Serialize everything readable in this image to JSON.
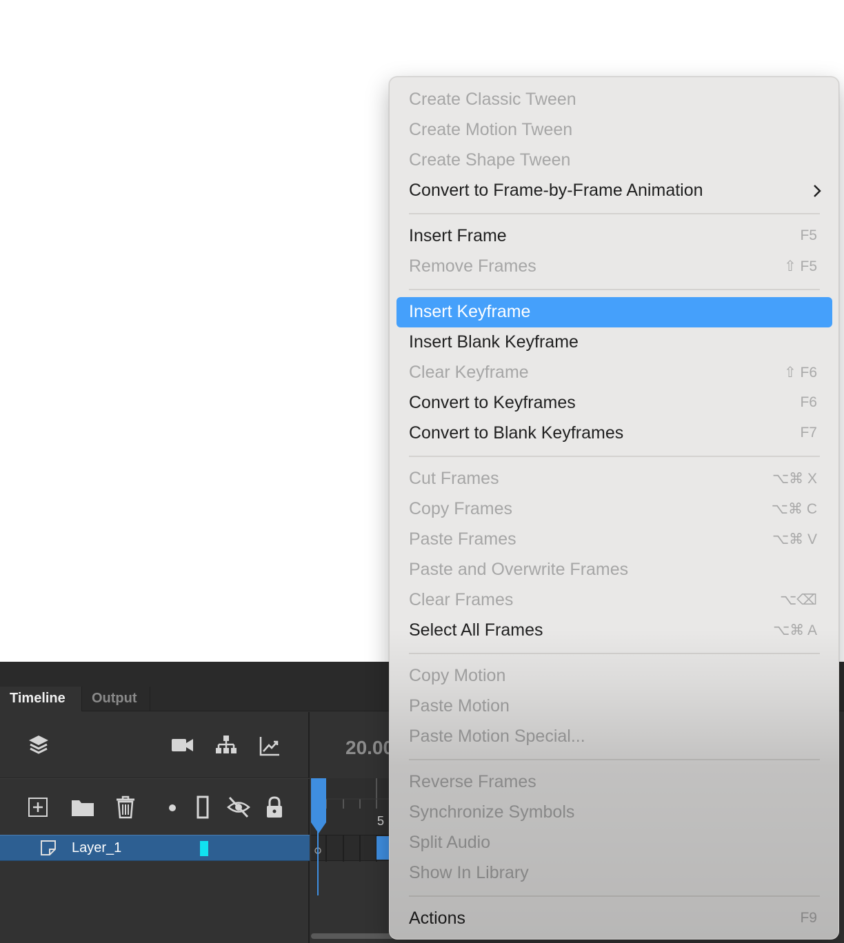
{
  "timeline": {
    "tabs": [
      "Timeline",
      "Output"
    ],
    "fps": "20.00",
    "frame_label": "5",
    "layer": {
      "name": "Layer_1",
      "color": "#11e2f0"
    }
  },
  "context_menu": {
    "items": [
      {
        "label": "Create Classic Tween",
        "shortcut": "",
        "disabled": true
      },
      {
        "label": "Create Motion Tween",
        "shortcut": "",
        "disabled": true
      },
      {
        "label": "Create Shape Tween",
        "shortcut": "",
        "disabled": true
      },
      {
        "label": "Convert to Frame-by-Frame Animation",
        "shortcut": "",
        "disabled": false,
        "submenu": true
      },
      {
        "label": "Insert Frame",
        "shortcut": "F5",
        "disabled": false
      },
      {
        "label": "Remove Frames",
        "shortcut": "⇧ F5",
        "disabled": true
      },
      {
        "label": "Insert Keyframe",
        "shortcut": "",
        "disabled": false,
        "selected": true
      },
      {
        "label": "Insert Blank Keyframe",
        "shortcut": "",
        "disabled": false
      },
      {
        "label": "Clear Keyframe",
        "shortcut": "⇧ F6",
        "disabled": true
      },
      {
        "label": "Convert to Keyframes",
        "shortcut": "F6",
        "disabled": false
      },
      {
        "label": "Convert to Blank Keyframes",
        "shortcut": "F7",
        "disabled": false
      },
      {
        "label": "Cut Frames",
        "shortcut": "⌥⌘ X",
        "disabled": true
      },
      {
        "label": "Copy Frames",
        "shortcut": "⌥⌘ C",
        "disabled": true
      },
      {
        "label": "Paste Frames",
        "shortcut": "⌥⌘ V",
        "disabled": true
      },
      {
        "label": "Paste and Overwrite Frames",
        "shortcut": "",
        "disabled": true
      },
      {
        "label": "Clear Frames",
        "shortcut": "⌥⌫",
        "disabled": true
      },
      {
        "label": "Select All Frames",
        "shortcut": "⌥⌘ A",
        "disabled": false
      },
      {
        "label": "Copy Motion",
        "shortcut": "",
        "disabled": true
      },
      {
        "label": "Paste Motion",
        "shortcut": "",
        "disabled": true
      },
      {
        "label": "Paste Motion Special...",
        "shortcut": "",
        "disabled": true
      },
      {
        "label": "Reverse Frames",
        "shortcut": "",
        "disabled": true
      },
      {
        "label": "Synchronize Symbols",
        "shortcut": "",
        "disabled": true
      },
      {
        "label": "Split Audio",
        "shortcut": "",
        "disabled": true
      },
      {
        "label": "Show In Library",
        "shortcut": "",
        "disabled": true
      },
      {
        "label": "Actions",
        "shortcut": "F9",
        "disabled": false
      }
    ],
    "colors": {
      "highlight": "#45a0fb",
      "background": "#e9e8e7"
    }
  }
}
